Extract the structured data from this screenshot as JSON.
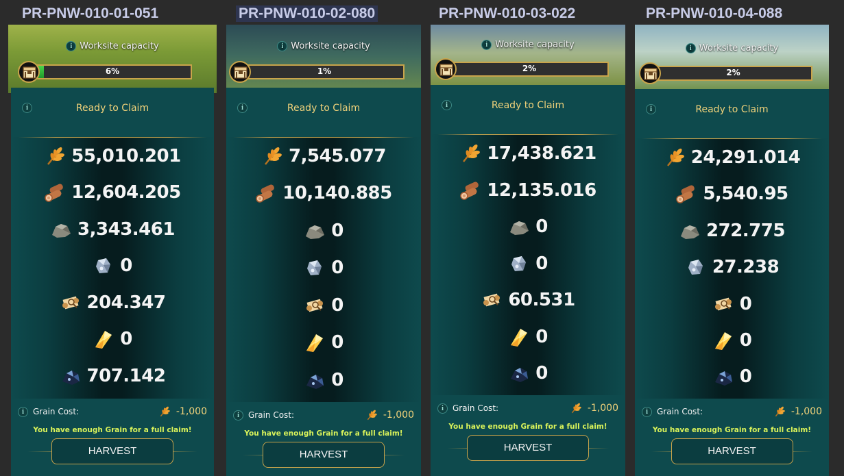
{
  "columns": [
    {
      "id": "PR-PNW-010-01-051",
      "capacity_label": "Worksite capacity",
      "capacity_pct": 6,
      "capacity_text": "6%",
      "ready_label": "Ready to Claim",
      "resources": [
        {
          "icon": "grain-icon",
          "value": "55,010.201"
        },
        {
          "icon": "wood-icon",
          "value": "12,604.205"
        },
        {
          "icon": "stone-icon",
          "value": "3,343.461"
        },
        {
          "icon": "iron-ore-icon",
          "value": "0"
        },
        {
          "icon": "scroll-icon",
          "value": "204.347"
        },
        {
          "icon": "crystal-icon",
          "value": "0"
        },
        {
          "icon": "dark-ore-icon",
          "value": "707.142"
        }
      ],
      "cost_label": "Grain Cost:",
      "cost_value": "-1,000",
      "enough_text": "You have enough Grain for a full claim!",
      "harvest_label": "HARVEST"
    },
    {
      "id": "PR-PNW-010-02-080",
      "capacity_label": "Worksite capacity",
      "capacity_pct": 1,
      "capacity_text": "1%",
      "ready_label": "Ready to Claim",
      "resources": [
        {
          "icon": "grain-icon",
          "value": "7,545.077"
        },
        {
          "icon": "wood-icon",
          "value": "10,140.885"
        },
        {
          "icon": "stone-icon",
          "value": "0"
        },
        {
          "icon": "iron-ore-icon",
          "value": "0"
        },
        {
          "icon": "scroll-icon",
          "value": "0"
        },
        {
          "icon": "crystal-icon",
          "value": "0"
        },
        {
          "icon": "dark-ore-icon",
          "value": "0"
        }
      ],
      "cost_label": "Grain Cost:",
      "cost_value": "-1,000",
      "enough_text": "You have enough Grain for a full claim!",
      "harvest_label": "HARVEST"
    },
    {
      "id": "PR-PNW-010-03-022",
      "capacity_label": "Worksite capacity",
      "capacity_pct": 2,
      "capacity_text": "2%",
      "ready_label": "Ready to Claim",
      "resources": [
        {
          "icon": "grain-icon",
          "value": "17,438.621"
        },
        {
          "icon": "wood-icon",
          "value": "12,135.016"
        },
        {
          "icon": "stone-icon",
          "value": "0"
        },
        {
          "icon": "iron-ore-icon",
          "value": "0"
        },
        {
          "icon": "scroll-icon",
          "value": "60.531"
        },
        {
          "icon": "crystal-icon",
          "value": "0"
        },
        {
          "icon": "dark-ore-icon",
          "value": "0"
        }
      ],
      "cost_label": "Grain Cost:",
      "cost_value": "-1,000",
      "enough_text": "You have enough Grain for a full claim!",
      "harvest_label": "HARVEST"
    },
    {
      "id": "PR-PNW-010-04-088",
      "capacity_label": "Worksite capacity",
      "capacity_pct": 2,
      "capacity_text": "2%",
      "ready_label": "Ready to Claim",
      "resources": [
        {
          "icon": "grain-icon",
          "value": "24,291.014"
        },
        {
          "icon": "wood-icon",
          "value": "5,540.95"
        },
        {
          "icon": "stone-icon",
          "value": "272.775"
        },
        {
          "icon": "iron-ore-icon",
          "value": "27.238"
        },
        {
          "icon": "scroll-icon",
          "value": "0"
        },
        {
          "icon": "crystal-icon",
          "value": "0"
        },
        {
          "icon": "dark-ore-icon",
          "value": "0"
        }
      ],
      "cost_label": "Grain Cost:",
      "cost_value": "-1,000",
      "enough_text": "You have enough Grain for a full claim!",
      "harvest_label": "HARVEST"
    }
  ]
}
